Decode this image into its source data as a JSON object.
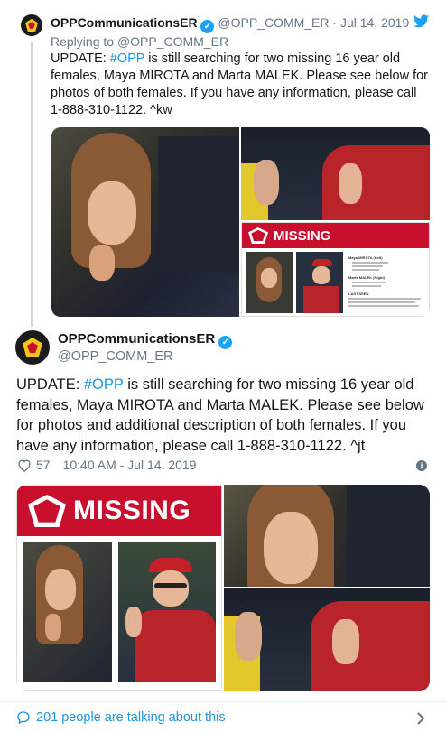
{
  "reply_tweet": {
    "display_name": "OPPCommunicationsER",
    "handle": "@OPP_COMM_ER",
    "separator": "·",
    "date": "Jul 14, 2019",
    "replying_prefix": "Replying to",
    "replying_handle": "@OPP_COMM_ER",
    "text_before_tag": "UPDATE: ",
    "hashtag": "#OPP",
    "text_after_tag": " is still searching for two missing 16 year old females, Maya MIROTA and Marta MALEK. Please see below for photos of both females. If you have any information, please call 1-888-310-1122. ^kw",
    "poster": {
      "missing_word": "MISSING",
      "info_line_1": "Maya MIROTA (Left)",
      "info_line_2": "Marta MALEK (Right)",
      "info_line_3": "LAST SEEN"
    }
  },
  "main_tweet": {
    "display_name": "OPPCommunicationsER",
    "handle": "@OPP_COMM_ER",
    "text_before_tag": "UPDATE: ",
    "hashtag": "#OPP",
    "text_after_tag": " is still searching for two missing 16 year old females, Maya MIROTA and Marta MALEK. Please see below for photos and additional description of both females. If you have any information, please call 1-888-310-1122. ^jt",
    "like_count": "57",
    "timestamp": "10:40 AM - Jul 14, 2019",
    "poster_missing_word": "MISSING"
  },
  "footer": {
    "talking_text": "201 people are talking about this"
  },
  "icons": {
    "twitter": "twitter-bird-icon",
    "verified": "verified-badge-icon",
    "heart": "heart-icon",
    "info": "info-icon",
    "comment": "comment-icon",
    "chevron": "chevron-right-icon"
  },
  "colors": {
    "twitter_blue": "#1da1f2",
    "link_blue": "#1b95e0",
    "missing_red": "#c8102e",
    "text_dark": "#14171a",
    "text_muted": "#657786"
  }
}
